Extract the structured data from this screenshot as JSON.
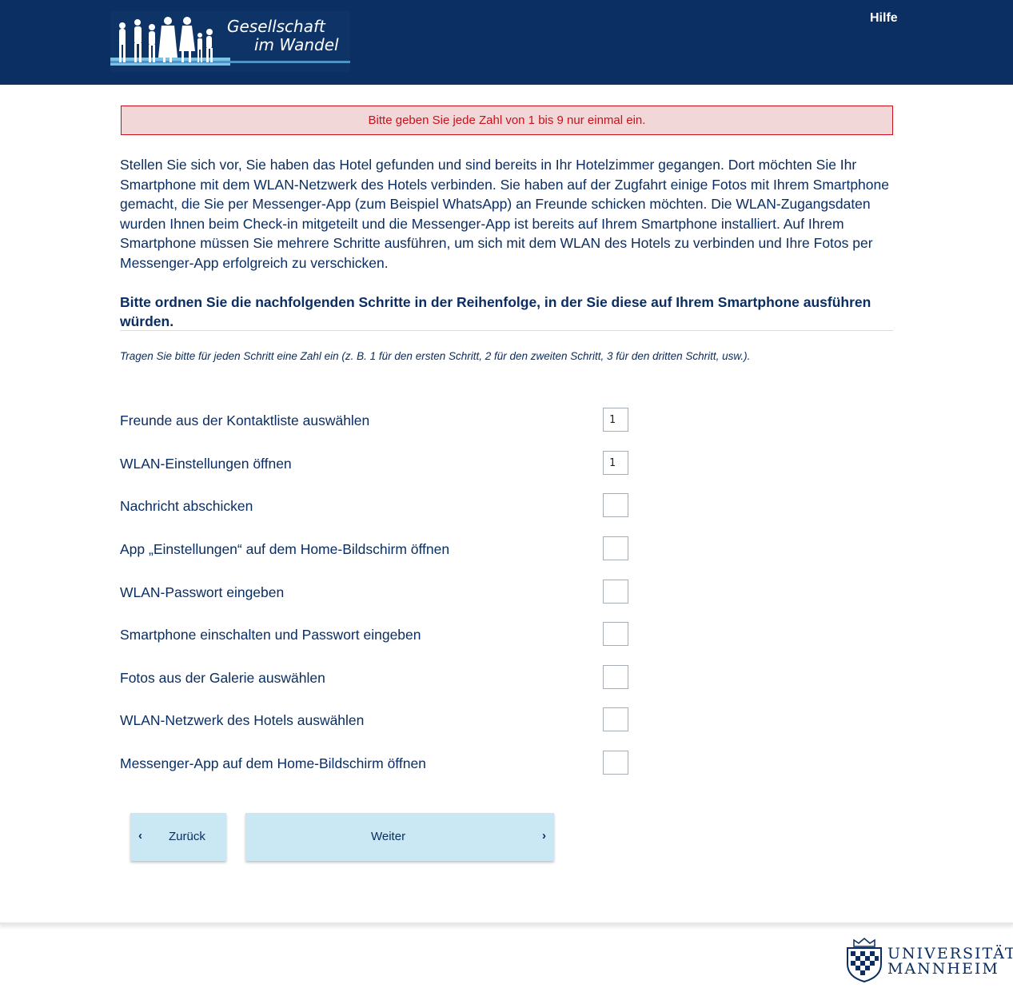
{
  "header": {
    "logo_line1": "Gesellschaft",
    "logo_line2": "im Wandel",
    "help_label": "Hilfe",
    "background": "#0b2f63"
  },
  "error": {
    "message": "Bitte geben Sie jede Zahl von 1 bis 9 nur einmal ein.",
    "color": "#c8111a"
  },
  "question": {
    "intro": "Stellen Sie sich vor, Sie haben das Hotel gefunden und sind bereits in Ihr Hotelzimmer gegangen. Dort möchten Sie Ihr Smartphone mit dem WLAN-Netzwerk des Hotels verbinden. Sie haben auf der Zugfahrt einige Fotos mit Ihrem Smartphone gemacht, die Sie per Messenger-App (zum Beispiel WhatsApp) an Freunde schicken möchten. Die WLAN-Zugangsdaten wurden Ihnen beim Check-in mitgeteilt und die Messenger-App ist bereits auf Ihrem Smartphone installiert. Auf Ihrem Smartphone müssen Sie mehrere Schritte ausführen, um sich mit dem WLAN des Hotels zu verbinden und Ihre Fotos per Messenger-App erfolgreich zu verschicken.",
    "instruction": "Bitte ordnen Sie die nachfolgenden Schritte in der Reihenfolge, in der Sie diese auf Ihrem Smartphone ausführen würden.",
    "hint": "Tragen Sie bitte für jeden Schritt eine Zahl ein (z. B. 1 für den ersten Schritt, 2 für den zweiten Schritt, 3 für den dritten Schritt, usw.)."
  },
  "items": [
    {
      "label": "Freunde aus der Kontaktliste auswählen",
      "value": "1"
    },
    {
      "label": "WLAN-Einstellungen öffnen",
      "value": "1"
    },
    {
      "label": "Nachricht abschicken",
      "value": ""
    },
    {
      "label": "App „Einstellungen“ auf dem Home-Bildschirm öffnen",
      "value": ""
    },
    {
      "label": "WLAN-Passwort eingeben",
      "value": ""
    },
    {
      "label": "Smartphone einschalten und Passwort eingeben",
      "value": ""
    },
    {
      "label": "Fotos aus der Galerie auswählen",
      "value": ""
    },
    {
      "label": "WLAN-Netzwerk des Hotels auswählen",
      "value": ""
    },
    {
      "label": "Messenger-App auf dem Home-Bildschirm öffnen",
      "value": ""
    }
  ],
  "nav": {
    "back_label": "Zurück",
    "next_label": "Weiter",
    "button_color": "#c9e8f4"
  },
  "footer": {
    "university_line1": "UNIVERSITÄT",
    "university_line2": "MANNHEIM"
  }
}
